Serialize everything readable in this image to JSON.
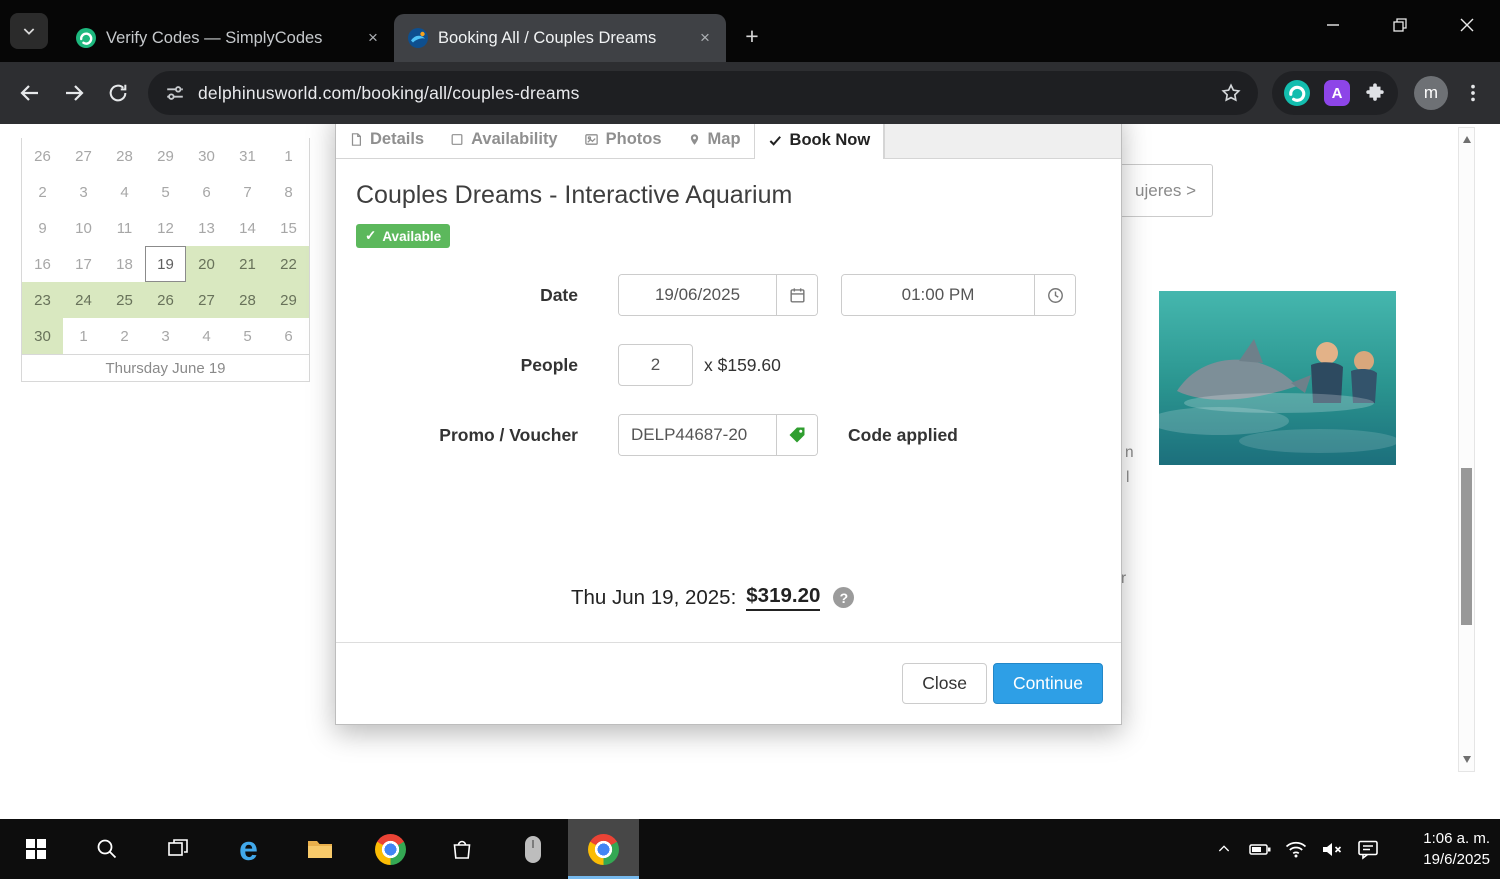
{
  "browser": {
    "tabs": [
      {
        "title": "Verify Codes — SimplyCodes"
      },
      {
        "title": "Booking All / Couples Dreams"
      }
    ],
    "url": "delphinusworld.com/booking/all/couples-dreams",
    "extension_letter": "A",
    "profile_initial": "m"
  },
  "calendar": {
    "caption": "Thursday June 19",
    "weeks": [
      [
        {
          "d": "26",
          "s": "dis"
        },
        {
          "d": "27",
          "s": "dis"
        },
        {
          "d": "28",
          "s": "dis"
        },
        {
          "d": "29",
          "s": "dis"
        },
        {
          "d": "30",
          "s": "dis"
        },
        {
          "d": "31",
          "s": "dis"
        },
        {
          "d": "1",
          "s": "dis"
        }
      ],
      [
        {
          "d": "2",
          "s": "dis"
        },
        {
          "d": "3",
          "s": "dis"
        },
        {
          "d": "4",
          "s": "dis"
        },
        {
          "d": "5",
          "s": "dis"
        },
        {
          "d": "6",
          "s": "dis"
        },
        {
          "d": "7",
          "s": "dis"
        },
        {
          "d": "8",
          "s": "dis"
        }
      ],
      [
        {
          "d": "9",
          "s": "dis"
        },
        {
          "d": "10",
          "s": "dis"
        },
        {
          "d": "11",
          "s": "dis"
        },
        {
          "d": "12",
          "s": "dis"
        },
        {
          "d": "13",
          "s": "dis"
        },
        {
          "d": "14",
          "s": "dis"
        },
        {
          "d": "15",
          "s": "dis"
        }
      ],
      [
        {
          "d": "16",
          "s": "dis"
        },
        {
          "d": "17",
          "s": "dis"
        },
        {
          "d": "18",
          "s": "dis"
        },
        {
          "d": "19",
          "s": "sel"
        },
        {
          "d": "20",
          "s": "avail"
        },
        {
          "d": "21",
          "s": "avail"
        },
        {
          "d": "22",
          "s": "avail"
        }
      ],
      [
        {
          "d": "23",
          "s": "avail"
        },
        {
          "d": "24",
          "s": "avail"
        },
        {
          "d": "25",
          "s": "avail"
        },
        {
          "d": "26",
          "s": "avail"
        },
        {
          "d": "27",
          "s": "avail"
        },
        {
          "d": "28",
          "s": "avail"
        },
        {
          "d": "29",
          "s": "avail"
        }
      ],
      [
        {
          "d": "30",
          "s": "avail"
        },
        {
          "d": "1",
          "s": "dis"
        },
        {
          "d": "2",
          "s": "dis"
        },
        {
          "d": "3",
          "s": "dis"
        },
        {
          "d": "4",
          "s": "dis"
        },
        {
          "d": "5",
          "s": "dis"
        },
        {
          "d": "6",
          "s": "dis"
        }
      ]
    ]
  },
  "page_bg": {
    "partial_button_label": "ujeres >",
    "fragments": [
      "n",
      "l",
      "r"
    ]
  },
  "modal": {
    "tabs": [
      {
        "label": "Details"
      },
      {
        "label": "Availability"
      },
      {
        "label": "Photos"
      },
      {
        "label": "Map"
      },
      {
        "label": "Book Now",
        "active": true
      }
    ],
    "title": "Couples Dreams - Interactive Aquarium",
    "badge": "Available",
    "form": {
      "date_label": "Date",
      "date_value": "19/06/2025",
      "time_value": "01:00 PM",
      "people_label": "People",
      "people_value": "2",
      "unit_price": "x $159.60",
      "promo_label": "Promo / Voucher",
      "promo_value": "DELP44687-20",
      "promo_status": "Code applied"
    },
    "total_label": "Thu Jun 19, 2025:",
    "total_value": "$319.20",
    "buttons": {
      "close": "Close",
      "continue": "Continue"
    }
  },
  "taskbar": {
    "time": "1:06 a. m.",
    "date": "19/6/2025"
  },
  "colors": {
    "accent_blue": "#2e9fe6",
    "available_green": "#5cb85c",
    "calendar_green": "#d9e8c0",
    "tag_green": "#2f9e2f"
  }
}
